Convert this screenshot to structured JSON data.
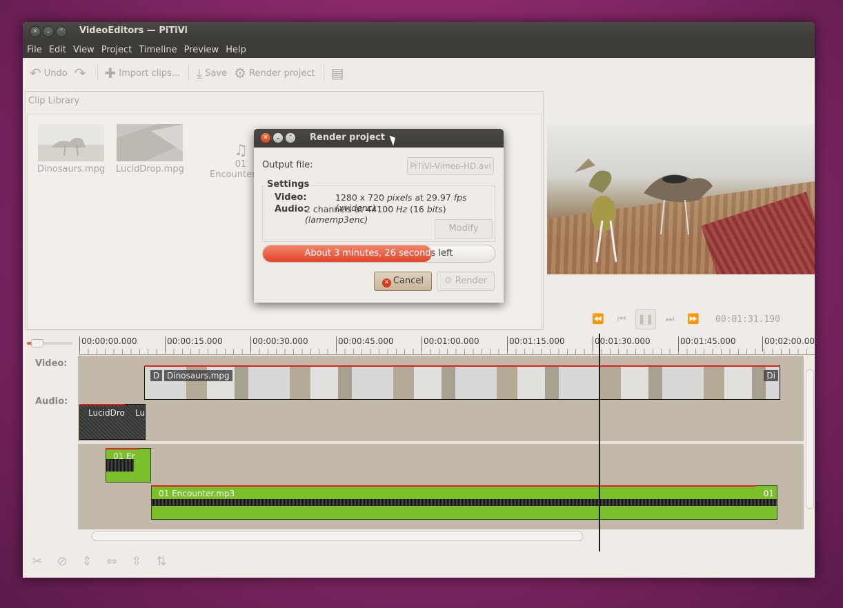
{
  "window": {
    "title": "VideoEditors — PiTiVi",
    "controls": [
      "close-icon",
      "minimize-icon",
      "maximize-icon"
    ]
  },
  "menu": [
    "File",
    "Edit",
    "View",
    "Project",
    "Timeline",
    "Preview",
    "Help"
  ],
  "toolbar": {
    "undo_label": "Undo",
    "import_label": "Import clips...",
    "save_label": "Save",
    "render_label": "Render project"
  },
  "library": {
    "title": "Clip Library",
    "clips": [
      {
        "name": "Dinosaurs.mpg"
      },
      {
        "name": "LucidDrop.mpg"
      },
      {
        "name": "01 Encounter.mp3",
        "line1": "01",
        "line2": "Encounter.mp"
      }
    ]
  },
  "viewer": {
    "timecode": "00:01:31.190"
  },
  "timeline": {
    "tracks": {
      "video_label": "Video:",
      "audio_label": "Audio:"
    },
    "ruler_ticks": [
      "00:00:00.000",
      "00:00:15.000",
      "00:00:30.000",
      "00:00:45.000",
      "00:01:00.000",
      "00:01:15.000",
      "00:01:30.000",
      "00:01:45.000",
      "00:02:00.000"
    ],
    "clips": {
      "lucid_label": "LucidDro",
      "lucid_label2": "Lu",
      "dino_label": "Dinosaurs.mpg",
      "dino_left_tag": "D",
      "dino_right_tag": "Di",
      "enc_short_label": "01 Er",
      "enc_label": "01 Encounter.mp3",
      "enc_right_tag": "01"
    }
  },
  "dialog": {
    "title": "Render project",
    "output_label": "Output file:",
    "output_value": "PiTiVi-Vimeo-HD.avi",
    "settings_label": "Settings",
    "video_label": "Video:",
    "video_res": "1280 x 720 ",
    "video_res_unit": "pixels",
    "video_at": " at 29.97 ",
    "video_fps_unit": "fps",
    "video_codec": " (xvidenc)",
    "audio_label": "Audio:",
    "audio_channels": "2 channels at 44100 ",
    "audio_hz": "Hz",
    "audio_bits_open": " (16 ",
    "audio_bits": "bits",
    "audio_bits_close": ") ",
    "audio_codec": "(lamemp3enc)",
    "modify_label": "Modify",
    "progress_text": "About 3 minutes, 26 seconds left",
    "progress_fraction": 0.73,
    "cancel_label": "Cancel",
    "render_label": "Render"
  },
  "colors": {
    "accent": "#e0442a",
    "audio_clip": "#7bc02c",
    "timeline_bg": "#c2b9a8"
  }
}
